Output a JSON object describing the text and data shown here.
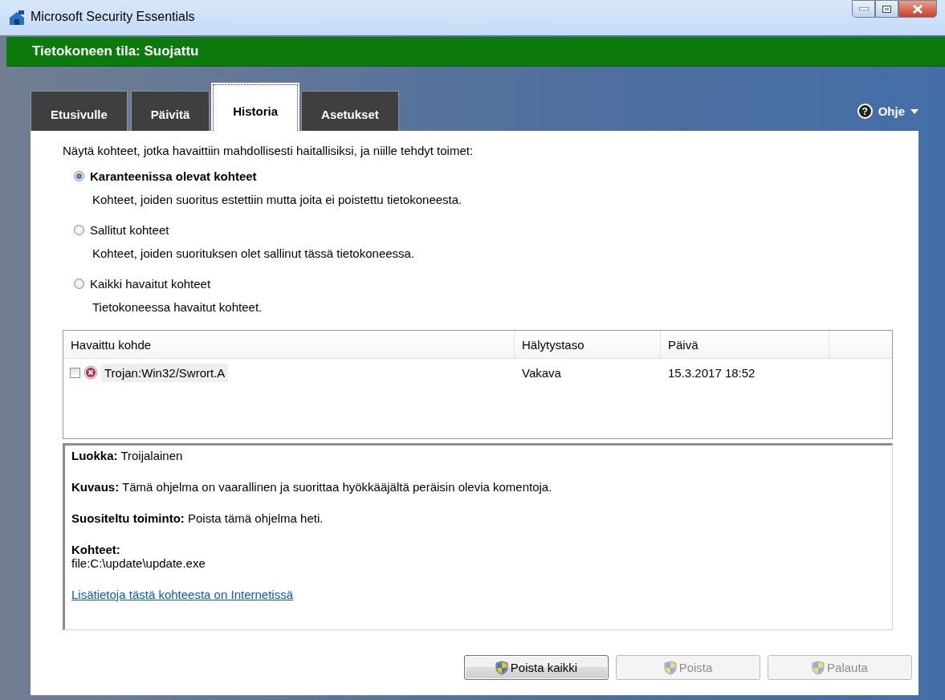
{
  "window": {
    "title": "Microsoft Security Essentials"
  },
  "status": {
    "label": "Tietokoneen tila: Suojattu"
  },
  "tabs": [
    {
      "label": "Etusivulle",
      "selected": false
    },
    {
      "label": "Päivitä",
      "selected": false
    },
    {
      "label": "Historia",
      "selected": true
    },
    {
      "label": "Asetukset",
      "selected": false
    }
  ],
  "help": {
    "icon": "?",
    "label": "Ohje"
  },
  "intro": "Näytä kohteet, jotka havaittiin mahdollisesti haitallisiksi, ja niille tehdyt toimet:",
  "filters": [
    {
      "label": "Karanteenissa olevat kohteet",
      "description": "Kohteet, joiden suoritus estettiin mutta joita ei poistettu tietokoneesta.",
      "selected": true
    },
    {
      "label": "Sallitut kohteet",
      "description": "Kohteet, joiden suorituksen olet sallinut tässä tietokoneessa.",
      "selected": false
    },
    {
      "label": "Kaikki havaitut kohteet",
      "description": "Tietokoneessa havaitut kohteet.",
      "selected": false
    }
  ],
  "table": {
    "columns": [
      "Havaittu kohde",
      "Hälytystaso",
      "Päivä"
    ],
    "rows": [
      {
        "checked": false,
        "name": "Trojan:Win32/Swrort.A",
        "alert_level": "Vakava",
        "date": "15.3.2017 18:52"
      }
    ]
  },
  "details": [
    {
      "kind": "field",
      "label": "Luokka:",
      "value": "Troijalainen"
    },
    {
      "kind": "field",
      "label": "Kuvaus:",
      "value": "Tämä ohjelma on vaarallinen ja suorittaa hyökkääjältä peräisin olevia komentoja."
    },
    {
      "kind": "field",
      "label": "Suositeltu toiminto:",
      "value": "Poista tämä ohjelma heti."
    },
    {
      "kind": "block",
      "label": "Kohteet:",
      "value": "file:C:\\update\\update.exe"
    },
    {
      "kind": "link",
      "value": "Lisätietoja tästä kohteesta on Internetissä"
    }
  ],
  "buttons": [
    {
      "label": "Poista kaikki",
      "disabled": false
    },
    {
      "label": "Poista",
      "disabled": true
    },
    {
      "label": "Palauta",
      "disabled": true
    }
  ]
}
